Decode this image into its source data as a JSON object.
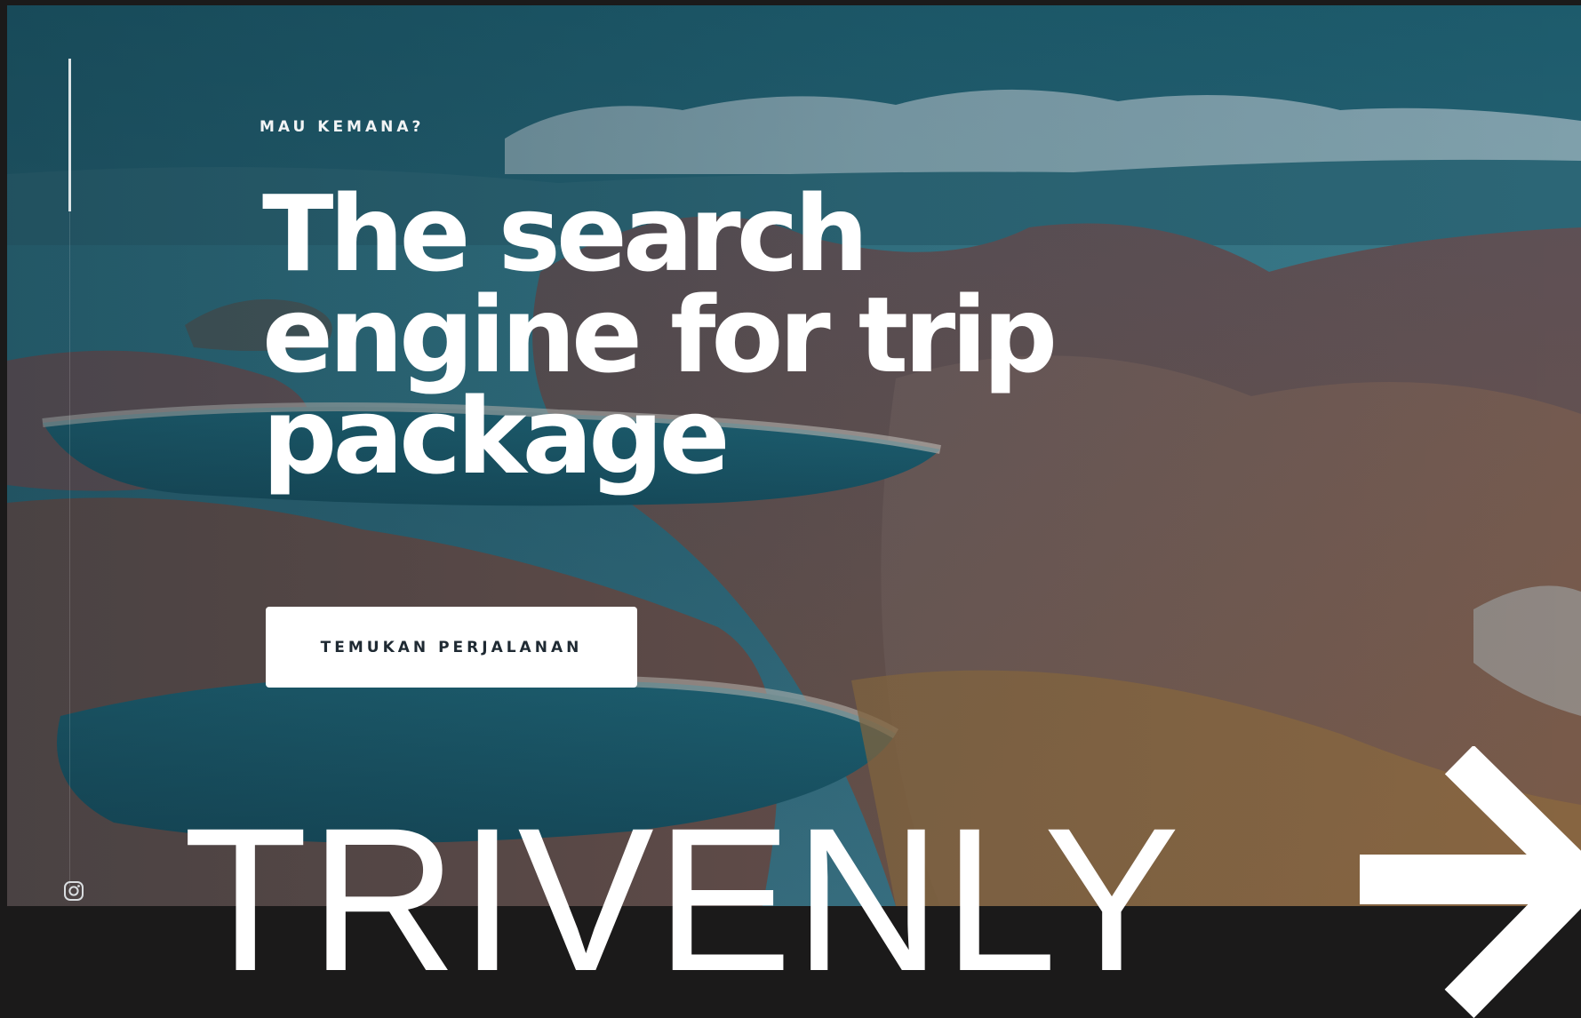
{
  "hero": {
    "eyebrow": "MAU KEMANA?",
    "headline_lines": [
      "The search",
      "engine for trip",
      "package"
    ],
    "cta_label": "TEMUKAN PERJALANAN"
  },
  "social": {
    "icon": "instagram-icon"
  },
  "brand": {
    "name": "TRIVENLY"
  },
  "navigation": {
    "next_icon": "arrow-right-icon"
  },
  "colors": {
    "page_background": "#1b1a1a",
    "overlay_tint": "#1f5a6a",
    "text": "#ffffff",
    "cta_background": "#ffffff",
    "cta_text": "#1f2a33"
  }
}
